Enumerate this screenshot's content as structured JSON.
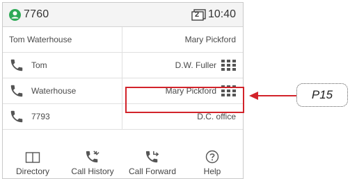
{
  "status_bar": {
    "extension": "7760",
    "line_count": "2",
    "time": "10:40"
  },
  "dsskeys": [
    {
      "left": {
        "label": "Tom Waterhouse",
        "icon": ""
      },
      "right": {
        "label": "Mary Pickford",
        "icon": ""
      }
    },
    {
      "left": {
        "label": "Tom",
        "icon": "phone-icon"
      },
      "right": {
        "label": "D.W. Fuller",
        "icon": "dialpad-icon"
      }
    },
    {
      "left": {
        "label": "Waterhouse",
        "icon": "phone-icon"
      },
      "right": {
        "label": "Mary Pickford",
        "icon": "dialpad-icon"
      }
    },
    {
      "left": {
        "label": "7793",
        "icon": "phone-icon"
      },
      "right": {
        "label": "D.C. office",
        "icon": ""
      }
    }
  ],
  "softkeys": [
    {
      "label": "Directory",
      "icon": "book-icon"
    },
    {
      "label": "Call History",
      "icon": "call-history-icon"
    },
    {
      "label": "Call Forward",
      "icon": "call-forward-icon"
    },
    {
      "label": "Help",
      "icon": "help-icon"
    }
  ],
  "callout": {
    "label": "P15"
  },
  "colors": {
    "accent_green": "#2eaa57",
    "highlight_red": "#d2232a",
    "icon_gray": "#555555"
  }
}
